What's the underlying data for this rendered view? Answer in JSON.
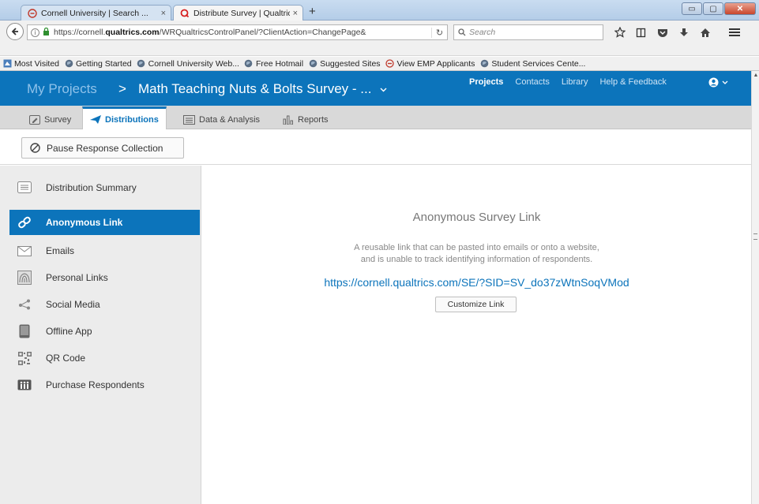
{
  "browser": {
    "tabs": [
      {
        "label": "Cornell University | Search ...",
        "close": "×"
      },
      {
        "label": "Distribute Survey | Qualtric...",
        "close": "×"
      }
    ],
    "new_tab": "+",
    "window_buttons": {
      "minimize": "▭",
      "maximize": "▢",
      "close": "✕"
    },
    "url_plain": "https://cornell.",
    "url_bold": "qualtrics.com",
    "url_rest": "/WRQualtricsControlPanel/?ClientAction=ChangePage&",
    "search_placeholder": "Search",
    "bookmarks": [
      "Most Visited",
      "Getting Started",
      "Cornell University Web...",
      "Free Hotmail",
      "Suggested Sites",
      "View EMP Applicants",
      "Student Services Cente..."
    ]
  },
  "header": {
    "projects_label": "My Projects",
    "separator": ">",
    "survey_title": "Math Teaching Nuts & Bolts Survey - ...",
    "nav": [
      "Projects",
      "Contacts",
      "Library",
      "Help & Feedback"
    ]
  },
  "tabs": [
    "Survey",
    "Distributions",
    "Data & Analysis",
    "Reports"
  ],
  "toolbar": {
    "pause_label": "Pause Response Collection"
  },
  "sidebar": {
    "items": [
      {
        "label": "Distribution Summary",
        "icon": "list-icon"
      },
      {
        "label": "Anonymous Link",
        "icon": "link-icon"
      },
      {
        "label": "Emails",
        "icon": "envelope-icon"
      },
      {
        "label": "Personal Links",
        "icon": "fingerprint-icon"
      },
      {
        "label": "Social Media",
        "icon": "share-icon"
      },
      {
        "label": "Offline App",
        "icon": "tablet-icon"
      },
      {
        "label": "QR Code",
        "icon": "qr-code-icon"
      },
      {
        "label": "Purchase Respondents",
        "icon": "people-icon"
      }
    ]
  },
  "main": {
    "title": "Anonymous Survey Link",
    "description_line1": "A reusable link that can be pasted into emails or onto a website,",
    "description_line2": "and is unable to track identifying information of respondents.",
    "link": "https://cornell.qualtrics.com/SE/?SID=SV_do37zWtnSoqVMod",
    "customize_label": "Customize Link"
  },
  "colors": {
    "brand": "#0c74bb",
    "sidebar_bg": "#ececec"
  }
}
